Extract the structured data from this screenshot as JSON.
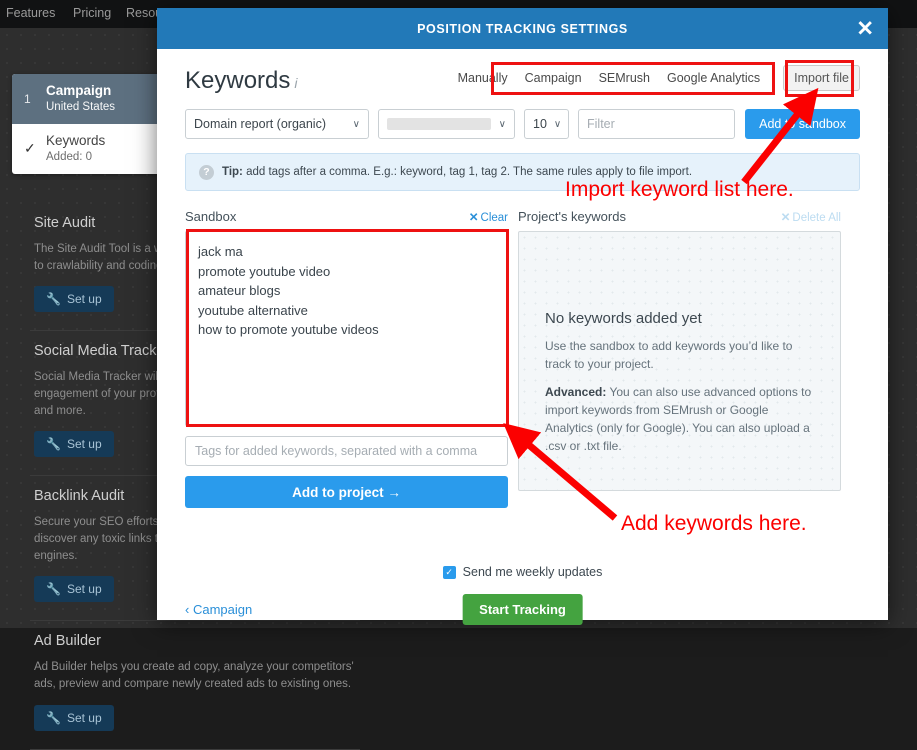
{
  "background": {
    "nav_items": [
      "Features",
      "Pricing",
      "Resources"
    ],
    "steps": [
      {
        "num": "1",
        "title": "Campaign",
        "sub": "United States",
        "state": "active"
      },
      {
        "check": "✓",
        "title": "Keywords",
        "sub": "Added: 0",
        "state": "done"
      }
    ],
    "cards": [
      {
        "title": "Site Audit",
        "text": "The Site Audit Tool is a web crawler that detects issues related to crawlability and coding.",
        "button": "Set up"
      },
      {
        "title": "Social Media Tracker",
        "text": "Social Media Tracker will let you compare activity and engagement of your profiles on Facebook, Twitter, Instagram and more.",
        "button": "Set up"
      },
      {
        "title": "Backlink Audit",
        "text": "Secure your SEO efforts in backlinks. Our algorithms help discover any toxic links that can lead to penalties by search engines.",
        "button": "Set up"
      },
      {
        "title": "Ad Builder",
        "text": "Ad Builder helps you create ad copy, analyze your competitors' ads, preview and compare newly created ads to existing ones.",
        "button": "Set up"
      }
    ]
  },
  "modal": {
    "title": "POSITION TRACKING SETTINGS",
    "close_label": "✕",
    "section_title": "Keywords",
    "section_info_icon": "i",
    "source_tabs": [
      "Manually",
      "Campaign",
      "SEMrush",
      "Google Analytics"
    ],
    "import_file_label": "Import file",
    "toolbar": {
      "report_select": "Domain report (organic)",
      "domain_select": "",
      "count_select": "10",
      "filter_placeholder": "Filter",
      "add_to_sandbox_label": "Add to sandbox",
      "caret": "∨"
    },
    "tip": {
      "icon": "?",
      "label": "Tip:",
      "text": " add tags after a comma. E.g.: keyword, tag 1, tag 2. The same rules apply to file import."
    },
    "sandbox": {
      "heading": "Sandbox",
      "clear_label": "Clear",
      "clear_x": "✕",
      "keywords": [
        "jack ma",
        "promote youtube video",
        "amateur blogs",
        "youtube alternative",
        "how to promote youtube videos"
      ],
      "tags_placeholder": "Tags for added keywords, separated with a comma",
      "add_to_project_label": "Add to project  →"
    },
    "project": {
      "heading": "Project's keywords",
      "delete_all_label": "Delete All",
      "delete_all_x": "✕",
      "empty_title": "No keywords added yet",
      "empty_p1": "Use the sandbox to add keywords you’d like to track to your project.",
      "empty_p2_bold": "Advanced:",
      "empty_p2": " You can also use advanced options to import keywords from SEMrush or Google Analytics (only for Google). You can also upload a .csv or .txt file."
    },
    "footer": {
      "weekly_checkbox_mark": "✓",
      "weekly_label": "Send me weekly updates",
      "back_label": "Campaign",
      "back_caret": "‹",
      "start_tracking_label": "Start Tracking"
    }
  },
  "annotations": {
    "import_note": "Import keyword list here.",
    "add_note": "Add keywords here.",
    "color": "#fb0000"
  }
}
